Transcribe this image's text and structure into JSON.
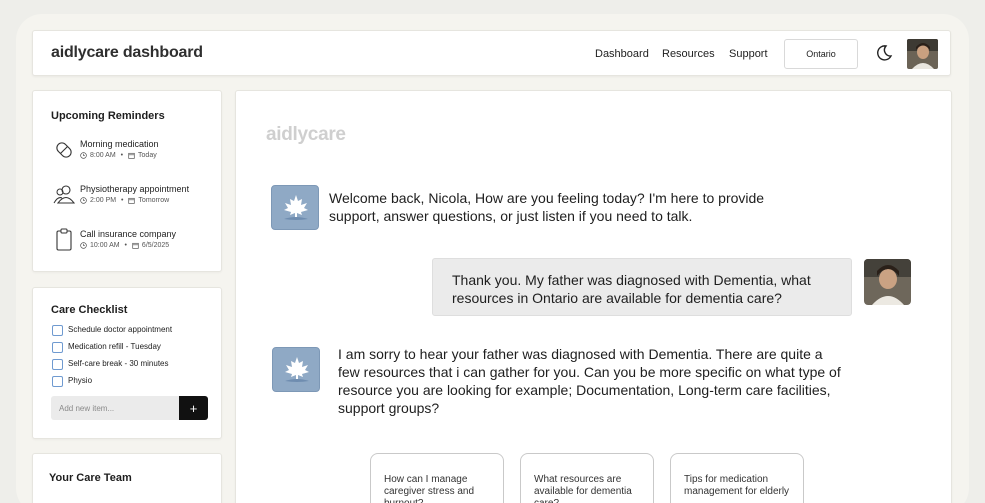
{
  "header": {
    "brand": "aidlycare dashboard",
    "nav": [
      "Dashboard",
      "Resources",
      "Support"
    ],
    "region": "Ontario"
  },
  "reminders": {
    "title": "Upcoming Reminders",
    "items": [
      {
        "title": "Morning medication",
        "time": "8:00 AM",
        "date": "Today",
        "icon": "pill-icon"
      },
      {
        "title": "Physiotherapy appointment",
        "time": "2:00 PM",
        "date": "Tomorrow",
        "icon": "people-icon"
      },
      {
        "title": "Call insurance company",
        "time": "10:00 AM",
        "date": "6/5/2025",
        "icon": "clipboard-icon"
      }
    ]
  },
  "checklist": {
    "title": "Care Checklist",
    "items": [
      "Schedule doctor appointment",
      "Medication refill - Tuesday",
      "Self-care break - 30 minutes",
      "Physio"
    ],
    "input_placeholder": "Add new item...",
    "add_label": "+"
  },
  "care_team": {
    "title": "Your Care Team"
  },
  "chat": {
    "logo": "aidlycare",
    "messages": [
      {
        "role": "assistant",
        "text": "Welcome back, Nicola,  How are you feeling today? I'm here to provide support, answer questions, or just listen if you need to talk."
      },
      {
        "role": "user",
        "text": "Thank you. My father was diagnosed with Dementia, what resources in Ontario are available for dementia care?"
      },
      {
        "role": "assistant",
        "text": "I am sorry to hear your father was diagnosed with Dementia. There are quite a few resources that i can gather for you. Can you be more specific on what type of resource you are looking for example; Documentation, Long-term care facilities, support groups?"
      }
    ],
    "suggestions": [
      "How can I manage caregiver stress and burnout?",
      "What resources are available for dementia care?",
      "Tips for medication management for elderly"
    ]
  },
  "colors": {
    "accent": "#8fa9c5",
    "checkbox": "#6f9ad0",
    "button": "#111111"
  }
}
